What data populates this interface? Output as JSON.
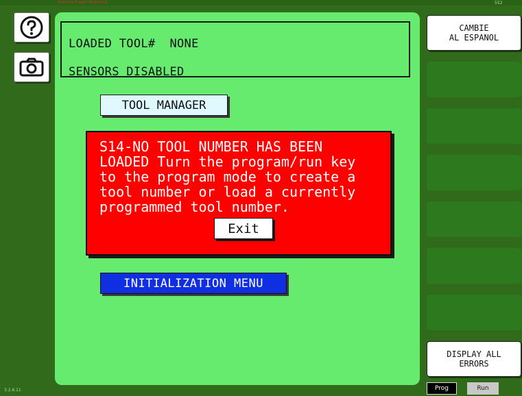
{
  "header": {
    "mode_indicator": "Remote Power Required",
    "screen_id": "552"
  },
  "left_toolbar": {
    "help_icon": "question-circle-icon",
    "camera_icon": "camera-icon"
  },
  "status": {
    "loaded_tool": "LOADED TOOL#  NONE",
    "sensors": "SENSORS DISABLED"
  },
  "buttons": {
    "tool_manager": "TOOL MANAGER",
    "initialization_menu": "INITIALIZATION MENU"
  },
  "alert": {
    "message": "S14-NO TOOL NUMBER HAS BEEN\nLOADED Turn the program/run key\nto the program mode to create a\ntool number or load a currently\nprogrammed tool number.",
    "exit_label": "Exit",
    "color": "#ff0000"
  },
  "right_panel": {
    "language_button": "CAMBIE\nAL ESPANOL",
    "display_errors_button": "DISPLAY ALL\nERRORS"
  },
  "footer": {
    "version": "3.2.6.11",
    "prog_label": "Prog",
    "run_label": "Run"
  }
}
